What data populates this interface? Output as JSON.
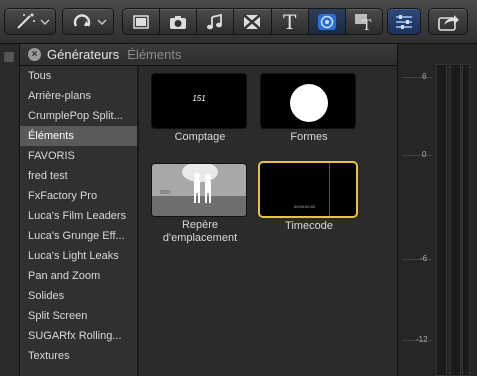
{
  "toolbar": {
    "left_buttons": [
      {
        "icon": "magic-wand-icon"
      },
      {
        "icon": "retime-icon"
      }
    ],
    "browser_segments": [
      {
        "icon": "film-browser-icon",
        "active": false
      },
      {
        "icon": "camera-icon",
        "active": false
      },
      {
        "icon": "music-note-icon",
        "active": false
      },
      {
        "icon": "transitions-icon",
        "active": false
      },
      {
        "icon": "titles-icon",
        "label": "T",
        "active": false
      },
      {
        "icon": "generators-icon",
        "active": true
      },
      {
        "icon": "themes-icon",
        "active": false
      }
    ],
    "right_buttons": [
      {
        "icon": "inspector-sliders-icon"
      },
      {
        "icon": "share-icon"
      }
    ]
  },
  "header": {
    "title": "Générateurs",
    "breadcrumb": "Éléments"
  },
  "sidebar": {
    "items": [
      {
        "label": "Tous",
        "selected": false
      },
      {
        "label": "Arrière-plans",
        "selected": false
      },
      {
        "label": "CrumplePop Split...",
        "selected": false
      },
      {
        "label": "Éléments",
        "selected": true
      },
      {
        "label": "FAVORIS",
        "selected": false
      },
      {
        "label": "fred test",
        "selected": false
      },
      {
        "label": "FxFactory Pro",
        "selected": false
      },
      {
        "label": "Luca's Film Leaders",
        "selected": false
      },
      {
        "label": "Luca's Grunge Eff...",
        "selected": false
      },
      {
        "label": "Luca's Light Leaks",
        "selected": false
      },
      {
        "label": "Pan and Zoom",
        "selected": false
      },
      {
        "label": "Solides",
        "selected": false
      },
      {
        "label": "Split Screen",
        "selected": false
      },
      {
        "label": "SUGARfx Rolling...",
        "selected": false
      },
      {
        "label": "Textures",
        "selected": false
      }
    ]
  },
  "tiles": [
    {
      "label": "Comptage",
      "thumb_text": "151"
    },
    {
      "label": "Formes"
    },
    {
      "label_line1": "Repère",
      "label_line2": "d'emplacement"
    },
    {
      "label": "Timecode",
      "thumb_text": "00:00:02:02"
    }
  ],
  "meter": {
    "ticks": [
      "6",
      "0",
      "-6",
      "-12"
    ]
  },
  "colors": {
    "selection_accent": "#e8c341",
    "active_segment": "#2b6fd6",
    "playhead": "#c0282b"
  }
}
